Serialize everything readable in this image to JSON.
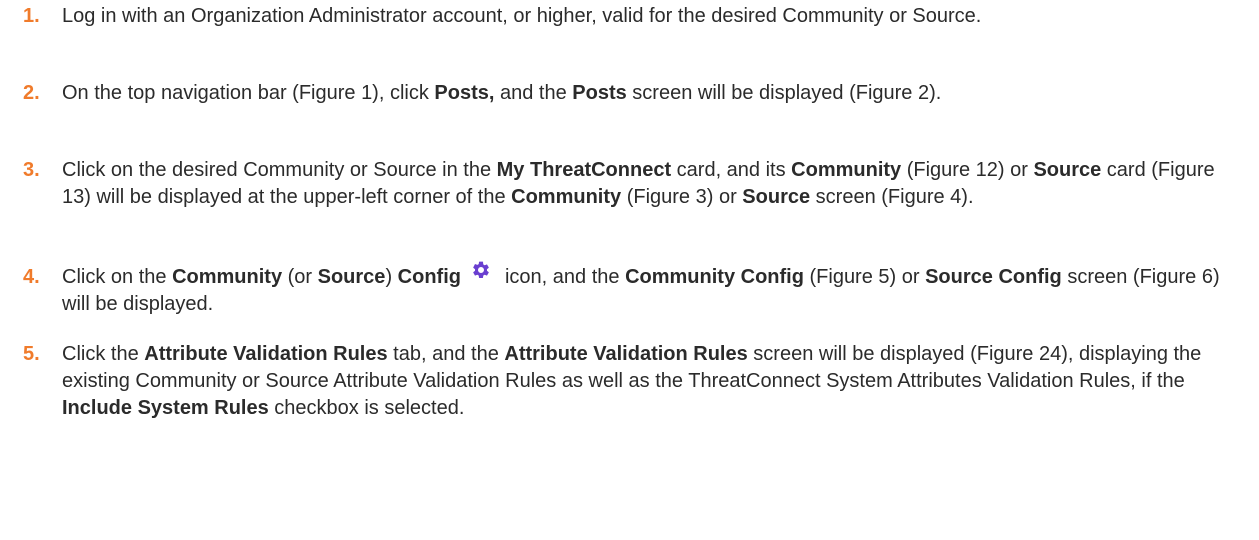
{
  "steps": [
    {
      "number": "1.",
      "parts": [
        "Log in with an Organization Administrator account, or higher, valid for the desired Community or Source."
      ]
    },
    {
      "number": "2.",
      "parts": [
        "On the top navigation bar (Figure 1), click ",
        "Posts,",
        " and the ",
        "Posts",
        " screen will be displayed (Figure 2)."
      ]
    },
    {
      "number": "3.",
      "parts": [
        "Click on the desired Community or Source in the ",
        "My ThreatConnect",
        " card, and its ",
        "Community",
        " (Figure 12) or ",
        "Source",
        " card (Figure 13) will be displayed at the upper-left corner of the ",
        "Community",
        " (Figure 3) or ",
        "Source",
        " screen (Figure 4)."
      ]
    },
    {
      "number": "4.",
      "parts": [
        "Click on the ",
        "Community",
        " (or ",
        "Source",
        ") ",
        "Config",
        "icon, and the ",
        "Community Config",
        " (Figure 5) or ",
        "Source Config",
        " screen (Figure 6) will be displayed."
      ]
    },
    {
      "number": "5.",
      "parts": [
        "Click the ",
        "Attribute Validation Rules",
        " tab, and the ",
        "Attribute Validation Rules",
        " screen will be displayed (Figure 24), displaying the existing Community or Source Attribute Validation Rules as well as the ThreatConnect System Attributes Validation Rules, if the ",
        "Include System Rules",
        " checkbox is selected."
      ]
    }
  ],
  "icons": {
    "config": "gear-icon"
  },
  "colors": {
    "step_number": "#f07b2b",
    "gear_icon": "#6a3fd0",
    "text": "#2b2b2b"
  }
}
